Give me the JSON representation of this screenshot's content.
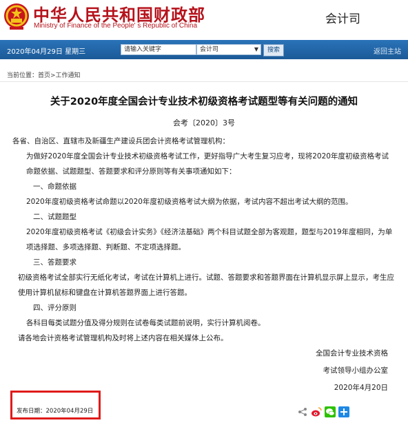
{
  "header": {
    "title_cn": "中华人民共和国财政部",
    "title_en": "Ministry of Finance of the People' s Republic of China",
    "department": "会计司"
  },
  "navbar": {
    "date": "2020年04月29日  星期三",
    "search_placeholder": "请输入关键字",
    "select_value": "会计司",
    "search_button": "搜索",
    "home_link": "返回主站"
  },
  "breadcrumb": "当前位置：首页>工作通知",
  "article": {
    "title": "关于2020年度全国会计专业技术初级资格考试题型等有关问题的通知",
    "doc_number": "会考〔2020〕3号",
    "salutation": "各省、自治区、直辖市及新疆生产建设兵团会计资格考试管理机构：",
    "intro": "为做好2020年度全国会计专业技术初级资格考试工作，更好指导广大考生复习应考，现将2020年度初级资格考试命题依据、试题题型、答题要求和评分原则等有关事项通知如下：",
    "section1_heading": "一、命题依据",
    "section1_text": "2020年度初级资格考试命题以2020年度初级资格考试大纲为依据，考试内容不超出考试大纲的范围。",
    "section2_heading": "二、试题题型",
    "section2_text": "2020年度初级资格考试《初级会计实务》《经济法基础》两个科目试题全部为客观题，题型与2019年度相同，为单项选择题、多项选择题、判断题、不定项选择题。",
    "section3_heading": "三、答题要求",
    "section3_text": "初级资格考试全部实行无纸化考试，考试在计算机上进行。试题、答题要求和答题界面在计算机显示屏上显示，考生应使用计算机鼠标和键盘在计算机答题界面上进行答题。",
    "section4_heading": "四、评分原则",
    "section4_text": "各科目每类试题分值及得分规则在试卷每类试题前说明，实行计算机阅卷。",
    "closing": "请各地会计资格考试管理机构及时将上述内容在相关媒体上公布。",
    "signature_line1": "全国会计专业技术资格",
    "signature_line2": "考试领导小组办公室",
    "signature_date": "2020年4月20日"
  },
  "footer": {
    "publish_date": "发布日期：2020年04月29日"
  },
  "colors": {
    "brand_red": "#b5121b",
    "nav_blue": "#2a73b8",
    "highlight_red": "#e01a1a"
  }
}
